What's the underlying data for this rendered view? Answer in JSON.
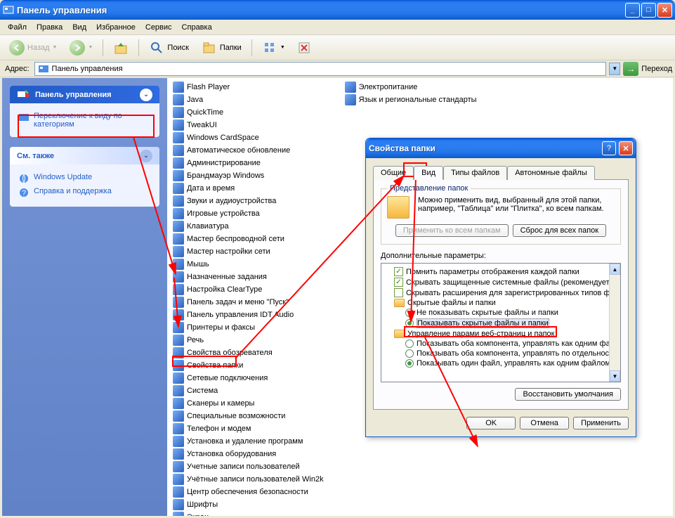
{
  "window": {
    "title": "Панель управления",
    "menu": [
      "Файл",
      "Правка",
      "Вид",
      "Избранное",
      "Сервис",
      "Справка"
    ],
    "toolbar": {
      "back": "Назад",
      "search": "Поиск",
      "folders": "Папки"
    },
    "address_label": "Адрес:",
    "address_value": "Панель управления",
    "go_label": "Переход"
  },
  "sidebar": {
    "panel1": {
      "title": "Панель управления",
      "link1": "Переключение к виду по категориям"
    },
    "panel2": {
      "title": "См. также",
      "link1": "Windows Update",
      "link2": "Справка и поддержка"
    }
  },
  "cp_items_col1": [
    "Flash Player",
    "Java",
    "QuickTime",
    "TweakUI",
    "Windows CardSpace",
    "Автоматическое обновление",
    "Администрирование",
    "Брандмауэр Windows",
    "Дата и время",
    "Звуки и аудиоустройства",
    "Игровые устройства",
    "Клавиатура",
    "Мастер беспроводной сети",
    "Мастер настройки сети",
    "Мышь",
    "Назначенные задания",
    "Настройка ClearType",
    "Панель задач и меню \"Пуск\"",
    "Панель управления IDT Audio",
    "Принтеры и факсы",
    "Речь",
    "Свойства обозревателя",
    "Свойства папки",
    "Сетевые подключения",
    "Система",
    "Сканеры и камеры",
    "Специальные возможности",
    "Телефон и модем",
    "Установка и удаление программ",
    "Установка оборудования",
    "Учетные записи пользователей",
    "Учётные записи пользователей Win2k",
    "Центр обеспечения безопасности",
    "Шрифты",
    "Экран"
  ],
  "cp_items_col2": [
    "Электропитание",
    "Язык и региональные стандарты"
  ],
  "dialog": {
    "title": "Свойства папки",
    "tabs": [
      "Общие",
      "Вид",
      "Типы файлов",
      "Автономные файлы"
    ],
    "group1_label": "Представление папок",
    "group1_text": "Можно применить вид, выбранный для этой папки, например, \"Таблица\" или \"Плитка\", ко всем папкам.",
    "apply_all": "Применить ко всем папкам",
    "reset_all": "Сброс для всех папок",
    "advanced_label": "Дополнительные параметры:",
    "adv": {
      "i1": "Помнить параметры отображения каждой папки",
      "i2": "Скрывать защищенные системные файлы (рекомендуется)",
      "i3": "Скрывать расширения для зарегистрированных типов файлов",
      "i4": "Скрытые файлы и папки",
      "i5": "Не показывать скрытые файлы и папки",
      "i6": "Показывать скрытые файлы и папки",
      "i7": "Управление парами веб-страниц и папок",
      "i8": "Показывать оба компонента, управлять как одним файлом",
      "i9": "Показывать оба компонента, управлять по отдельности",
      "i10": "Показывать один файл, управлять как одним файлом"
    },
    "restore": "Восстановить умолчания",
    "ok": "OK",
    "cancel": "Отмена",
    "apply": "Применить"
  }
}
